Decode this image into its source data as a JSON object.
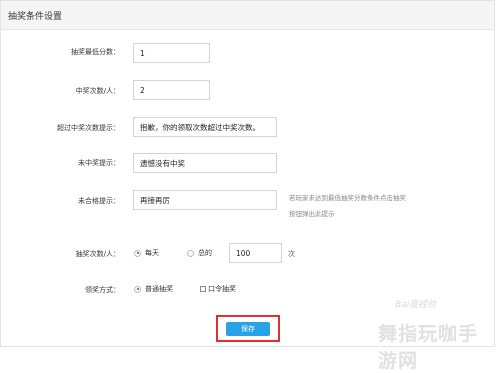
{
  "header": {
    "title": "抽奖条件设置"
  },
  "form": {
    "min_score": {
      "label": "抽奖最低分数：",
      "value": "1"
    },
    "win_per_person": {
      "label": "中奖次数/人：",
      "value": "2"
    },
    "exceed_tip": {
      "label": "超过中奖次数提示：",
      "value": "抱歉，你的领取次数超过中奖次数。"
    },
    "not_win_tip": {
      "label": "未中奖提示：",
      "value": "遗憾没有中奖"
    },
    "unqualified_tip": {
      "label": "未合格提示：",
      "value": "再接再厉",
      "hint_line1": "若玩家未达到最低抽奖分数条件点击抽奖",
      "hint_line2": "按钮弹出此提示"
    },
    "draw_times": {
      "label": "抽奖次数/人：",
      "options": [
        "每天",
        "总的"
      ],
      "selected": "每天",
      "value": "100",
      "unit": "次"
    },
    "claim_method": {
      "label": "领奖方式：",
      "radio_label": "普通抽奖",
      "checkbox_label": "口令抽奖"
    }
  },
  "save_button": {
    "label": "保存"
  },
  "watermark": {
    "text": "舞指玩咖手游网",
    "baidu": "Bai度经验"
  }
}
